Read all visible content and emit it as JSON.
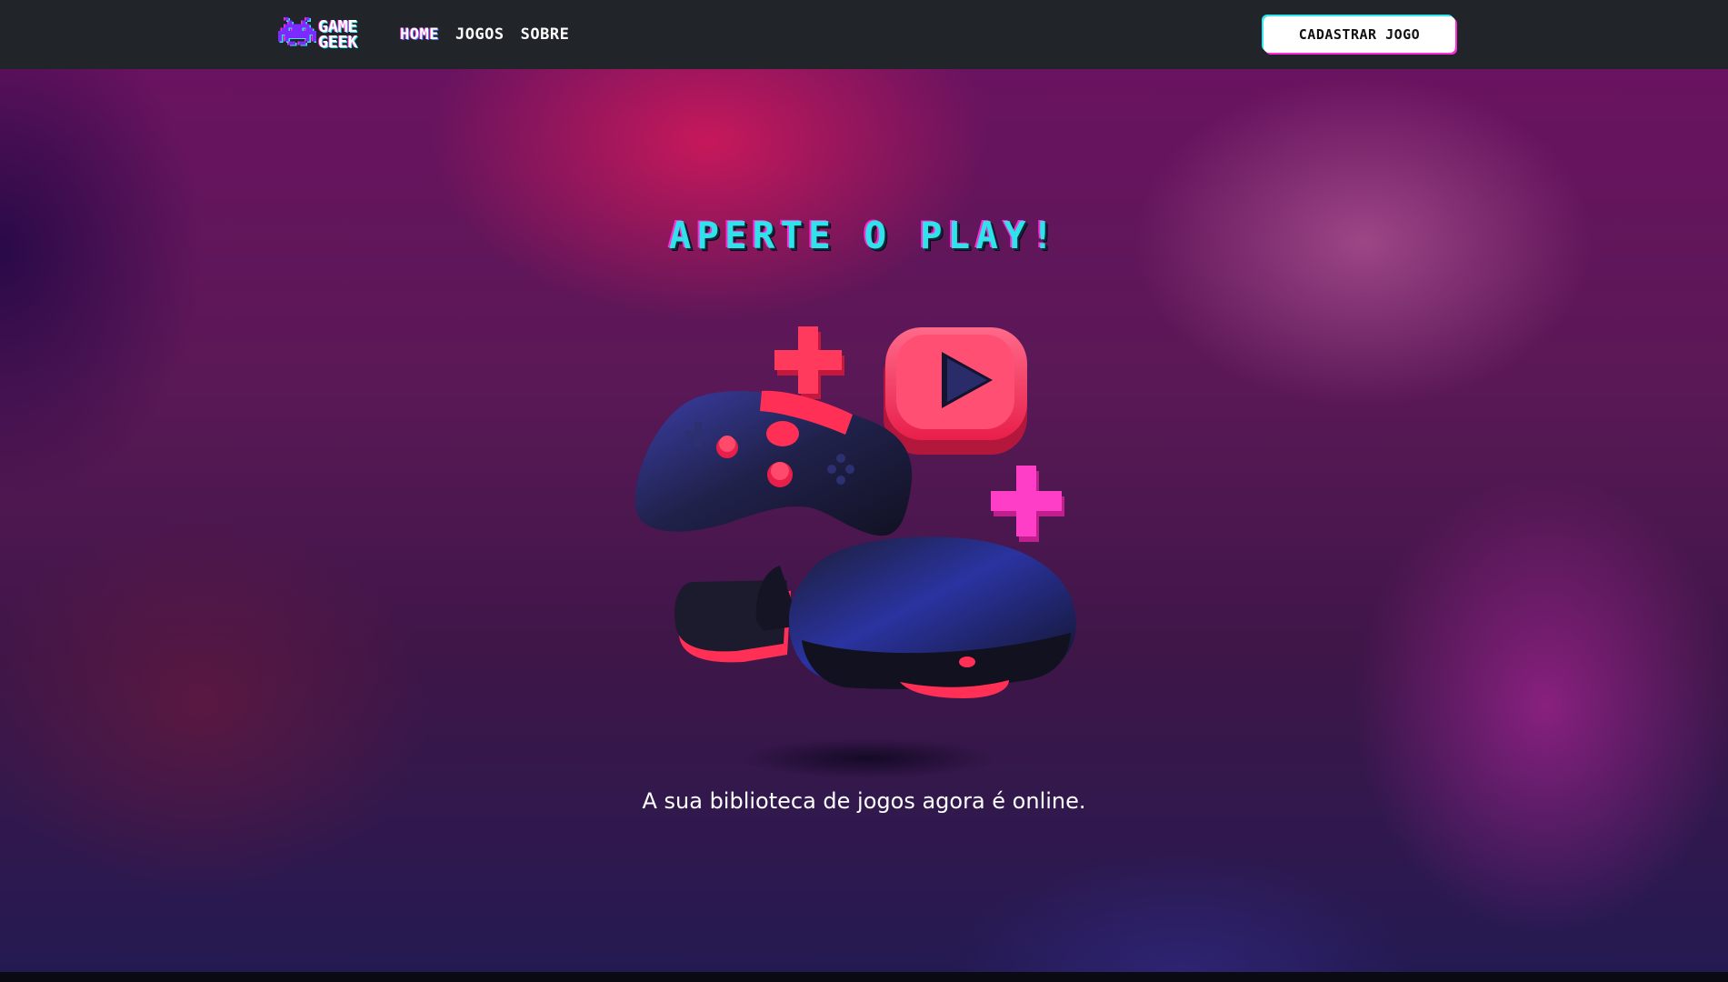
{
  "nav": {
    "brand": {
      "line1": "GAME",
      "line2": "GEEK",
      "icon": "space-invader-icon"
    },
    "links": [
      {
        "label": "HOME",
        "active": true
      },
      {
        "label": "JOGOS",
        "active": false
      },
      {
        "label": "SOBRE",
        "active": false
      }
    ],
    "cta_label": "CADASTRAR JOGO"
  },
  "hero": {
    "title": "APERTE O PLAY!",
    "tagline": "A sua biblioteca de jogos agora é online.",
    "illustration": "gaming-controller-vr-headset-play-illustration"
  },
  "colors": {
    "navbar": "#212529",
    "accent_cyan": "#36e6ee",
    "accent_magenta": "#ff2bd6",
    "hero_pink": "#ff2f5a"
  }
}
